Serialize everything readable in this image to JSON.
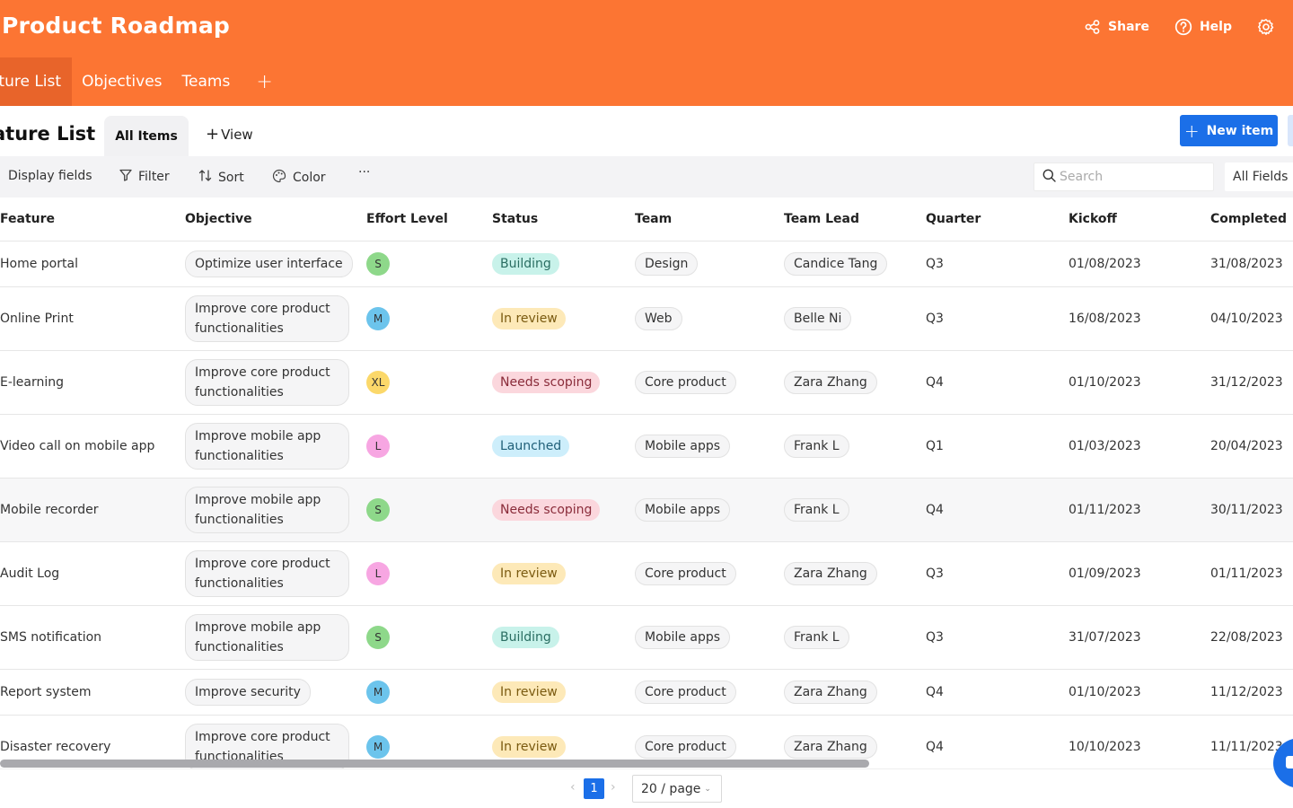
{
  "app": {
    "title": "Product Roadmap",
    "actions": {
      "share": "Share",
      "help": "Help"
    }
  },
  "tabs": [
    {
      "label": "Feature List",
      "display": "ature List"
    },
    {
      "label": "Objectives"
    },
    {
      "label": "Teams"
    }
  ],
  "view": {
    "title": "Feature List",
    "title_display": "ature List",
    "active_view": "All Items",
    "add_view": "View",
    "new_item": "New item"
  },
  "toolbar": {
    "display_fields": "Display fields",
    "filter": "Filter",
    "sort": "Sort",
    "color": "Color",
    "more": "···",
    "search_placeholder": "Search",
    "search_scope": "All Fields"
  },
  "table": {
    "columns": [
      "Feature",
      "Objective",
      "Effort Level",
      "Status",
      "Team",
      "Team Lead",
      "Quarter",
      "Kickoff",
      "Completed"
    ],
    "rows": [
      {
        "feature": "Home portal",
        "objective": "Optimize user interface",
        "effort": "S",
        "status": "Building",
        "team": "Design",
        "lead": "Candice Tang",
        "quarter": "Q3",
        "kickoff": "01/08/2023",
        "completed": "31/08/2023"
      },
      {
        "feature": "Online Print",
        "objective": "Improve core product functionalities",
        "effort": "M",
        "status": "In review",
        "team": "Web",
        "lead": "Belle Ni",
        "quarter": "Q3",
        "kickoff": "16/08/2023",
        "completed": "04/10/2023"
      },
      {
        "feature": "E-learning",
        "objective": "Improve core product functionalities",
        "effort": "XL",
        "status": "Needs scoping",
        "team": "Core product",
        "lead": "Zara Zhang",
        "quarter": "Q4",
        "kickoff": "01/10/2023",
        "completed": "31/12/2023"
      },
      {
        "feature": "Video call on mobile app",
        "objective": "Improve mobile app functionalities",
        "effort": "L",
        "status": "Launched",
        "team": "Mobile apps",
        "lead": "Frank L",
        "quarter": "Q1",
        "kickoff": "01/03/2023",
        "completed": "20/04/2023"
      },
      {
        "feature": "Mobile recorder",
        "objective": "Improve mobile app functionalities",
        "effort": "S",
        "status": "Needs scoping",
        "team": "Mobile apps",
        "lead": "Frank L",
        "quarter": "Q4",
        "kickoff": "01/11/2023",
        "completed": "30/11/2023"
      },
      {
        "feature": "Audit Log",
        "objective": "Improve core product functionalities",
        "effort": "L",
        "status": "In review",
        "team": "Core product",
        "lead": "Zara Zhang",
        "quarter": "Q3",
        "kickoff": "01/09/2023",
        "completed": "01/11/2023"
      },
      {
        "feature": "SMS notification",
        "objective": "Improve mobile app functionalities",
        "effort": "S",
        "status": "Building",
        "team": "Mobile apps",
        "lead": "Frank L",
        "quarter": "Q3",
        "kickoff": "31/07/2023",
        "completed": "22/08/2023"
      },
      {
        "feature": "Report system",
        "objective": "Improve security",
        "effort": "M",
        "status": "In review",
        "team": "Core product",
        "lead": "Zara Zhang",
        "quarter": "Q4",
        "kickoff": "01/10/2023",
        "completed": "11/12/2023"
      },
      {
        "feature": "Disaster recovery",
        "objective": "Improve core product functionalities",
        "effort": "M",
        "status": "In review",
        "team": "Core product",
        "lead": "Zara Zhang",
        "quarter": "Q4",
        "kickoff": "10/10/2023",
        "completed": "11/11/2023"
      }
    ]
  },
  "colors": {
    "brand": "#fc7533",
    "primary": "#1b6fe8",
    "effort": {
      "S": "#8ed88a",
      "M": "#6cc4ec",
      "XL": "#fbd86a",
      "L": "#f7a6e2"
    },
    "status": {
      "Building": {
        "bg": "#c8f2ea",
        "fg": "#2a6e62"
      },
      "In review": {
        "bg": "#fde9b8",
        "fg": "#7a5a10"
      },
      "Needs scoping": {
        "bg": "#fbd7dd",
        "fg": "#8a2c3a"
      },
      "Launched": {
        "bg": "#cdeefb",
        "fg": "#1f5f78"
      }
    }
  },
  "pagination": {
    "current": "1",
    "page_size": "20 / page"
  }
}
